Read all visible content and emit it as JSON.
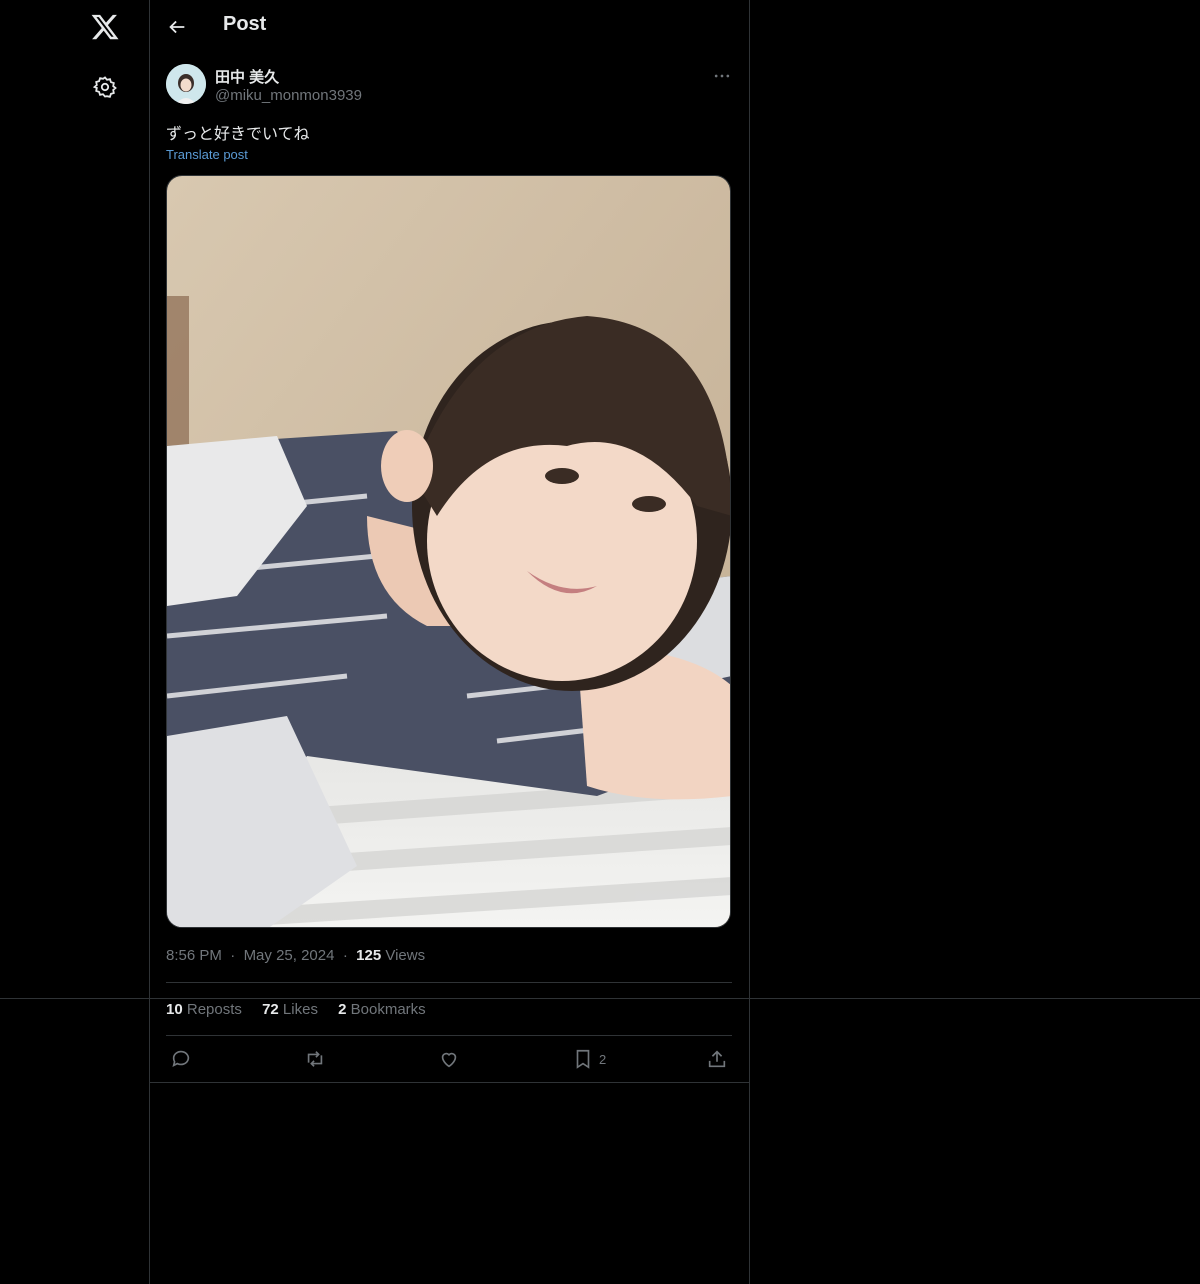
{
  "header": {
    "title": "Post"
  },
  "post": {
    "author": {
      "display_name": "田中 美久",
      "handle": "@miku_monmon3939"
    },
    "text": "ずっと好きでいてね",
    "translate_label": "Translate post",
    "time": "8:56 PM",
    "date": "May 25, 2024",
    "views_count": "125",
    "views_label": "Views",
    "dot": "·"
  },
  "stats": {
    "reposts_count": "10",
    "reposts_label": "Reposts",
    "likes_count": "72",
    "likes_label": "Likes",
    "bookmarks_count": "2",
    "bookmarks_label": "Bookmarks"
  },
  "actions": {
    "bookmark_count": "2"
  },
  "icons": {
    "logo": "x-logo-icon",
    "settings": "gear-icon",
    "back": "arrow-left-icon",
    "more": "more-horizontal-icon",
    "reply": "reply-icon",
    "repost": "repost-icon",
    "like": "heart-icon",
    "bookmark": "bookmark-icon",
    "share": "share-icon"
  },
  "colors": {
    "background": "#000000",
    "text": "#e7e9ea",
    "muted": "#71767b",
    "link": "#5b9bd5",
    "border": "#2f3336"
  }
}
